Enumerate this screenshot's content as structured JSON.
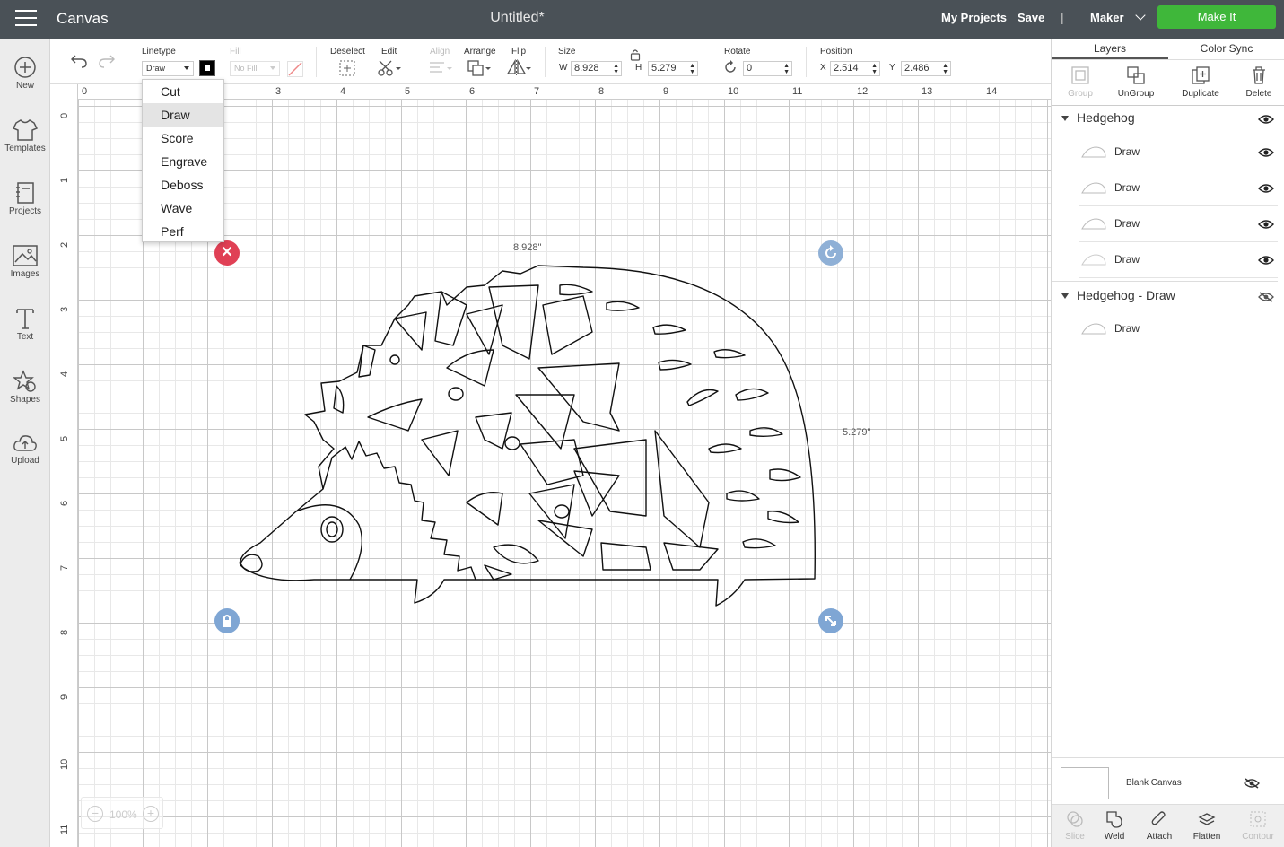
{
  "topbar": {
    "app_title": "Canvas",
    "doc_title": "Untitled*",
    "my_projects": "My Projects",
    "save": "Save",
    "divider": "|",
    "machine": "Maker",
    "make_it": "Make It",
    "make_it_color": "#3fb73a"
  },
  "sidebar": {
    "items": [
      {
        "label": "New",
        "icon": "plus-circle-icon"
      },
      {
        "label": "Templates",
        "icon": "tshirt-icon"
      },
      {
        "label": "Projects",
        "icon": "notebook-icon"
      },
      {
        "label": "Images",
        "icon": "image-icon"
      },
      {
        "label": "Text",
        "icon": "text-icon"
      },
      {
        "label": "Shapes",
        "icon": "shapes-icon"
      },
      {
        "label": "Upload",
        "icon": "cloud-upload-icon"
      }
    ]
  },
  "toolbar": {
    "linetype_label": "Linetype",
    "linetype_value": "Draw",
    "fill_label": "Fill",
    "fill_value": "No Fill",
    "deselect_label": "Deselect",
    "edit_label": "Edit",
    "align_label": "Align",
    "arrange_label": "Arrange",
    "flip_label": "Flip",
    "size_label": "Size",
    "w_axis": "W",
    "w_value": "8.928",
    "h_axis": "H",
    "h_value": "5.279",
    "rotate_label": "Rotate",
    "rotate_value": "0",
    "position_label": "Position",
    "x_axis": "X",
    "x_value": "2.514",
    "y_axis": "Y",
    "y_value": "2.486"
  },
  "linetype_menu": {
    "options": [
      "Cut",
      "Draw",
      "Score",
      "Engrave",
      "Deboss",
      "Wave",
      "Perf"
    ],
    "selected": "Draw"
  },
  "canvas": {
    "h_ruler": [
      "0",
      "3",
      "4",
      "5",
      "6",
      "7",
      "8",
      "9",
      "10",
      "11",
      "12",
      "13",
      "14"
    ],
    "v_ruler": [
      "0",
      "1",
      "2",
      "3",
      "4",
      "5",
      "6",
      "7",
      "8",
      "9",
      "10",
      "11"
    ],
    "width_label": "8.928\"",
    "height_label": "5.279\"",
    "zoom": "100%"
  },
  "layers_panel": {
    "tabs": [
      "Layers",
      "Color Sync"
    ],
    "tools": [
      {
        "label": "Group",
        "icon": "group-icon",
        "enabled": false
      },
      {
        "label": "UnGroup",
        "icon": "ungroup-icon",
        "enabled": true
      },
      {
        "label": "Duplicate",
        "icon": "duplicate-icon",
        "enabled": true
      },
      {
        "label": "Delete",
        "icon": "trash-icon",
        "enabled": true
      }
    ],
    "groups": [
      {
        "name": "Hedgehog",
        "visible": true,
        "layers": [
          {
            "name": "Draw",
            "visible": true
          },
          {
            "name": "Draw",
            "visible": true
          },
          {
            "name": "Draw",
            "visible": true
          },
          {
            "name": "Draw",
            "visible": true
          }
        ]
      },
      {
        "name": "Hedgehog - Draw",
        "visible": false,
        "layers": [
          {
            "name": "Draw"
          }
        ]
      }
    ],
    "blank_canvas": "Blank Canvas",
    "bottom_tools": [
      {
        "label": "Slice",
        "icon": "slice-icon",
        "enabled": false
      },
      {
        "label": "Weld",
        "icon": "weld-icon",
        "enabled": true
      },
      {
        "label": "Attach",
        "icon": "paperclip-icon",
        "enabled": true
      },
      {
        "label": "Flatten",
        "icon": "flatten-icon",
        "enabled": true
      },
      {
        "label": "Contour",
        "icon": "contour-icon",
        "enabled": false
      }
    ]
  }
}
